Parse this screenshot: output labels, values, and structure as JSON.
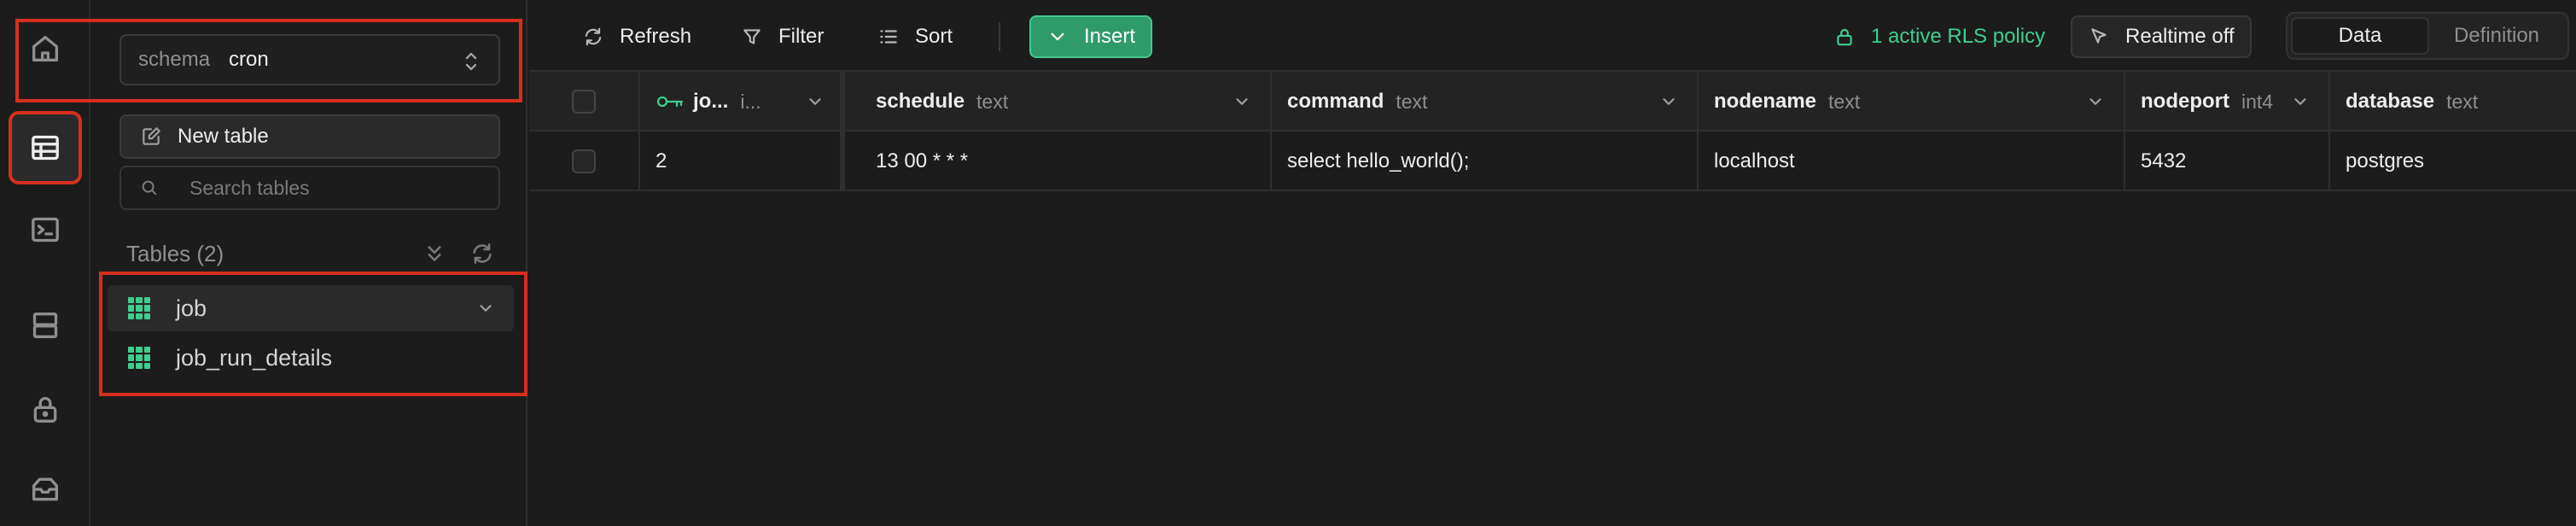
{
  "rail": {
    "items": [
      {
        "name": "home",
        "icon": "home-icon",
        "active": false
      },
      {
        "name": "table-editor",
        "icon": "table-icon",
        "active": true
      },
      {
        "name": "sql-editor",
        "icon": "terminal-icon",
        "active": false
      },
      {
        "name": "database",
        "icon": "database-icon",
        "active": false
      },
      {
        "name": "authentication",
        "icon": "lock-icon",
        "active": false
      },
      {
        "name": "storage",
        "icon": "archive-icon",
        "active": false
      }
    ]
  },
  "sidebar": {
    "schema_label": "schema",
    "schema_value": "cron",
    "new_table_label": "New table",
    "search_placeholder": "Search tables",
    "tables_heading": "Tables (2)",
    "tables": [
      {
        "name": "job",
        "selected": true
      },
      {
        "name": "job_run_details",
        "selected": false
      }
    ]
  },
  "toolbar": {
    "refresh_label": "Refresh",
    "filter_label": "Filter",
    "sort_label": "Sort",
    "insert_label": "Insert",
    "rls_label": "1 active RLS policy",
    "realtime_label": "Realtime off",
    "view_tabs": [
      "Data",
      "Definition"
    ],
    "active_view": "Data"
  },
  "grid": {
    "columns": [
      {
        "name": "jo...",
        "type": "i...",
        "primary_key": true
      },
      {
        "name": "schedule",
        "type": "text"
      },
      {
        "name": "command",
        "type": "text"
      },
      {
        "name": "nodename",
        "type": "text"
      },
      {
        "name": "nodeport",
        "type": "int4"
      },
      {
        "name": "database",
        "type": "text"
      }
    ],
    "rows": [
      [
        "2",
        "13 00 * * *",
        "select hello_world();",
        "localhost",
        "5432",
        "postgres"
      ]
    ]
  },
  "colors": {
    "accent_green": "#3ecf8e",
    "insert_button": "#2f9a6a",
    "highlight_red": "#d62f1e",
    "background": "#1c1c1c"
  }
}
